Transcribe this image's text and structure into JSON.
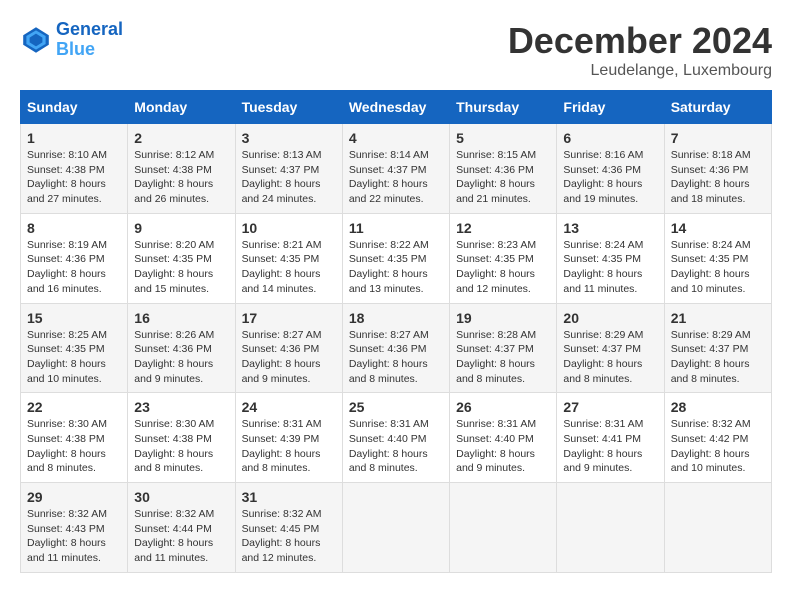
{
  "header": {
    "logo_line1": "General",
    "logo_line2": "Blue",
    "month_title": "December 2024",
    "location": "Leudelange, Luxembourg"
  },
  "days_of_week": [
    "Sunday",
    "Monday",
    "Tuesday",
    "Wednesday",
    "Thursday",
    "Friday",
    "Saturday"
  ],
  "weeks": [
    [
      {
        "day": "1",
        "text": "Sunrise: 8:10 AM\nSunset: 4:38 PM\nDaylight: 8 hours\nand 27 minutes."
      },
      {
        "day": "2",
        "text": "Sunrise: 8:12 AM\nSunset: 4:38 PM\nDaylight: 8 hours\nand 26 minutes."
      },
      {
        "day": "3",
        "text": "Sunrise: 8:13 AM\nSunset: 4:37 PM\nDaylight: 8 hours\nand 24 minutes."
      },
      {
        "day": "4",
        "text": "Sunrise: 8:14 AM\nSunset: 4:37 PM\nDaylight: 8 hours\nand 22 minutes."
      },
      {
        "day": "5",
        "text": "Sunrise: 8:15 AM\nSunset: 4:36 PM\nDaylight: 8 hours\nand 21 minutes."
      },
      {
        "day": "6",
        "text": "Sunrise: 8:16 AM\nSunset: 4:36 PM\nDaylight: 8 hours\nand 19 minutes."
      },
      {
        "day": "7",
        "text": "Sunrise: 8:18 AM\nSunset: 4:36 PM\nDaylight: 8 hours\nand 18 minutes."
      }
    ],
    [
      {
        "day": "8",
        "text": "Sunrise: 8:19 AM\nSunset: 4:36 PM\nDaylight: 8 hours\nand 16 minutes."
      },
      {
        "day": "9",
        "text": "Sunrise: 8:20 AM\nSunset: 4:35 PM\nDaylight: 8 hours\nand 15 minutes."
      },
      {
        "day": "10",
        "text": "Sunrise: 8:21 AM\nSunset: 4:35 PM\nDaylight: 8 hours\nand 14 minutes."
      },
      {
        "day": "11",
        "text": "Sunrise: 8:22 AM\nSunset: 4:35 PM\nDaylight: 8 hours\nand 13 minutes."
      },
      {
        "day": "12",
        "text": "Sunrise: 8:23 AM\nSunset: 4:35 PM\nDaylight: 8 hours\nand 12 minutes."
      },
      {
        "day": "13",
        "text": "Sunrise: 8:24 AM\nSunset: 4:35 PM\nDaylight: 8 hours\nand 11 minutes."
      },
      {
        "day": "14",
        "text": "Sunrise: 8:24 AM\nSunset: 4:35 PM\nDaylight: 8 hours\nand 10 minutes."
      }
    ],
    [
      {
        "day": "15",
        "text": "Sunrise: 8:25 AM\nSunset: 4:35 PM\nDaylight: 8 hours\nand 10 minutes."
      },
      {
        "day": "16",
        "text": "Sunrise: 8:26 AM\nSunset: 4:36 PM\nDaylight: 8 hours\nand 9 minutes."
      },
      {
        "day": "17",
        "text": "Sunrise: 8:27 AM\nSunset: 4:36 PM\nDaylight: 8 hours\nand 9 minutes."
      },
      {
        "day": "18",
        "text": "Sunrise: 8:27 AM\nSunset: 4:36 PM\nDaylight: 8 hours\nand 8 minutes."
      },
      {
        "day": "19",
        "text": "Sunrise: 8:28 AM\nSunset: 4:37 PM\nDaylight: 8 hours\nand 8 minutes."
      },
      {
        "day": "20",
        "text": "Sunrise: 8:29 AM\nSunset: 4:37 PM\nDaylight: 8 hours\nand 8 minutes."
      },
      {
        "day": "21",
        "text": "Sunrise: 8:29 AM\nSunset: 4:37 PM\nDaylight: 8 hours\nand 8 minutes."
      }
    ],
    [
      {
        "day": "22",
        "text": "Sunrise: 8:30 AM\nSunset: 4:38 PM\nDaylight: 8 hours\nand 8 minutes."
      },
      {
        "day": "23",
        "text": "Sunrise: 8:30 AM\nSunset: 4:38 PM\nDaylight: 8 hours\nand 8 minutes."
      },
      {
        "day": "24",
        "text": "Sunrise: 8:31 AM\nSunset: 4:39 PM\nDaylight: 8 hours\nand 8 minutes."
      },
      {
        "day": "25",
        "text": "Sunrise: 8:31 AM\nSunset: 4:40 PM\nDaylight: 8 hours\nand 8 minutes."
      },
      {
        "day": "26",
        "text": "Sunrise: 8:31 AM\nSunset: 4:40 PM\nDaylight: 8 hours\nand 9 minutes."
      },
      {
        "day": "27",
        "text": "Sunrise: 8:31 AM\nSunset: 4:41 PM\nDaylight: 8 hours\nand 9 minutes."
      },
      {
        "day": "28",
        "text": "Sunrise: 8:32 AM\nSunset: 4:42 PM\nDaylight: 8 hours\nand 10 minutes."
      }
    ],
    [
      {
        "day": "29",
        "text": "Sunrise: 8:32 AM\nSunset: 4:43 PM\nDaylight: 8 hours\nand 11 minutes."
      },
      {
        "day": "30",
        "text": "Sunrise: 8:32 AM\nSunset: 4:44 PM\nDaylight: 8 hours\nand 11 minutes."
      },
      {
        "day": "31",
        "text": "Sunrise: 8:32 AM\nSunset: 4:45 PM\nDaylight: 8 hours\nand 12 minutes."
      },
      {
        "day": "",
        "text": ""
      },
      {
        "day": "",
        "text": ""
      },
      {
        "day": "",
        "text": ""
      },
      {
        "day": "",
        "text": ""
      }
    ]
  ]
}
